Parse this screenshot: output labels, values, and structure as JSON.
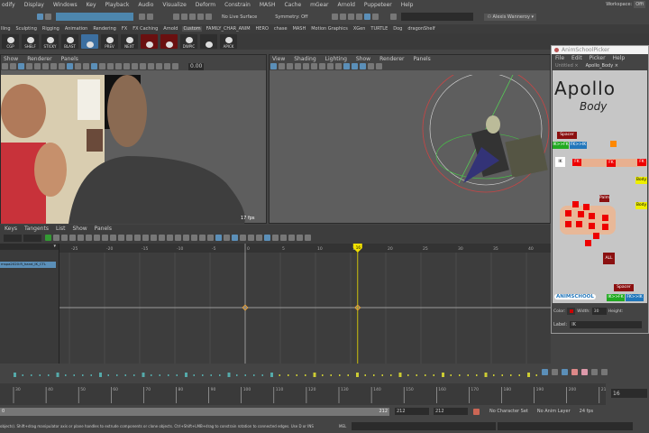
{
  "menu": [
    "odify",
    "Display",
    "Windows",
    "Key",
    "Playback",
    "Audio",
    "Visualize",
    "Deform",
    "Constrain",
    "MASH",
    "Cache",
    "mGear",
    "Arnold",
    "Puppeteer",
    "Help"
  ],
  "workspace_label": "Workspace:",
  "workspace_value": "Offi",
  "toolbar": {
    "live_surface": "No Live Surface",
    "symmetry": "Symmetry: Off",
    "user": "Alexis Wanneroy"
  },
  "shelf_tabs": [
    "lling",
    "Sculpting",
    "Rigging",
    "Animation",
    "Rendering",
    "FX",
    "FX Caching",
    "Arnold",
    "Custom",
    "FAMILY_CHAR_ANIM",
    "HERO",
    "chase",
    "MASH",
    "Motion Graphics",
    "XGen",
    "TURTLE",
    "Dog",
    "dragonShelf"
  ],
  "shelf_active": "Custom",
  "shelf_buttons": [
    "CGP",
    "SHELF",
    "STICKY",
    "BLAST",
    "",
    "PREV",
    "NEXT",
    "",
    "",
    "DWPIC",
    "",
    "APICK"
  ],
  "viewport_left": {
    "menu": [
      "Show",
      "Renderer",
      "Panels"
    ],
    "value": "0.00",
    "fps": "17 fps"
  },
  "viewport_right": {
    "menu": [
      "View",
      "Shading",
      "Lighting",
      "Show",
      "Renderer",
      "Panels"
    ]
  },
  "picker": {
    "title": "AnimSchoolPicker",
    "menu": [
      "File",
      "Edit",
      "Picker",
      "Help"
    ],
    "tabs": [
      "Untitled",
      "Apollo_Body"
    ],
    "logo_top": "Apollo",
    "logo_sub": "Body",
    "buttons": {
      "spacer": "Spacer",
      "ik_fk": "IK>>FK",
      "fk_ik": "FK>>IK",
      "ik": "IK",
      "fk": "FK",
      "palm": "Palm",
      "all": "ALL",
      "body": "Body"
    },
    "brand": "ANIMSCHOOL",
    "color_label": "Color:",
    "width_label": "Width:",
    "width_value": "30",
    "height_label": "Height:",
    "label_label": "Label:",
    "label_value": "IK"
  },
  "graph_editor": {
    "menu": [
      "Keys",
      "Tangents",
      "List",
      "Show",
      "Panels"
    ],
    "outliner_item": "mspa2020:R_hand_IK_CTL",
    "ticks": [
      -25,
      -20,
      -15,
      -10,
      -5,
      0,
      5,
      10,
      15,
      20,
      25,
      30,
      35,
      40
    ],
    "keys": [
      0,
      16
    ],
    "current_frame": 16
  },
  "timeline": {
    "ticks": [
      30,
      40,
      50,
      60,
      70,
      80,
      90,
      100,
      110,
      120,
      130,
      140,
      150,
      160,
      170,
      180,
      190,
      200,
      210
    ],
    "current_frame": "16",
    "range_start": "0",
    "range_end": "212",
    "field_a": "212",
    "field_b": "212",
    "character_set": "No Character Set",
    "anim_layer": "No Anim Layer",
    "fps": "24 fps"
  },
  "status": {
    "help": "objects). Shift+drag manipulator axis or plane handles to extrude components or clone objects. Ctrl+Shift+LMB+drag to constrain rotation to connected edges. Use D or INS",
    "mel": "MEL"
  },
  "colors": {
    "accent": "#5b8fb8",
    "current_time": "#f0e000",
    "key_red": "#e00000"
  }
}
